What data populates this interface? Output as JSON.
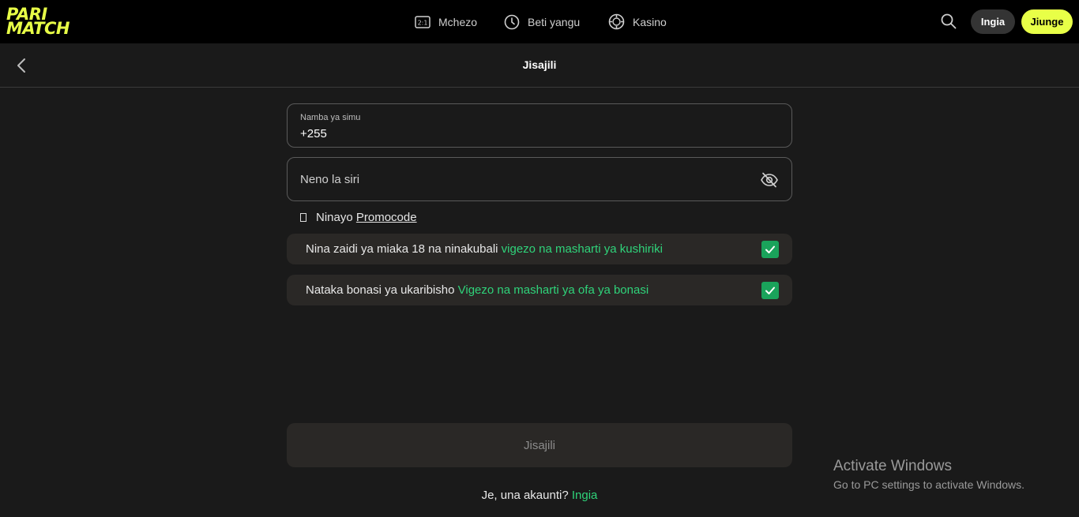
{
  "brand": {
    "line1": "PARI",
    "line2": "MATCH",
    "color": "#e8ff47"
  },
  "nav": [
    {
      "label": "Mchezo",
      "icon": "scoreboard-icon"
    },
    {
      "label": "Beti yangu",
      "icon": "clock-icon"
    },
    {
      "label": "Kasino",
      "icon": "casino-chip-icon"
    }
  ],
  "header": {
    "login_label": "Ingia",
    "join_label": "Jiunge"
  },
  "page": {
    "title": "Jisajili"
  },
  "form": {
    "phone_label": "Namba ya simu",
    "phone_value": "+255",
    "password_placeholder": "Neno la siri",
    "promo_prefix": "Ninayo",
    "promo_link": "Promocode",
    "consent1_text": "Nina zaidi ya miaka 18 na ninakubali",
    "consent1_link": "vigezo na masharti ya kushiriki",
    "consent1_checked": true,
    "consent2_text": "Nataka bonasi ya ukaribisho",
    "consent2_link": "Vigezo na masharti ya ofa ya bonasi",
    "consent2_checked": true,
    "submit_label": "Jisajili",
    "account_question": "Je, una akaunti?",
    "account_link": "Ingia"
  },
  "watermark": {
    "line1": "Activate Windows",
    "line2": "Go to PC settings to activate Windows."
  },
  "colors": {
    "accent_green": "#2fd37a",
    "checkbox_green": "#1aa35b",
    "background": "#1a1a1a"
  }
}
